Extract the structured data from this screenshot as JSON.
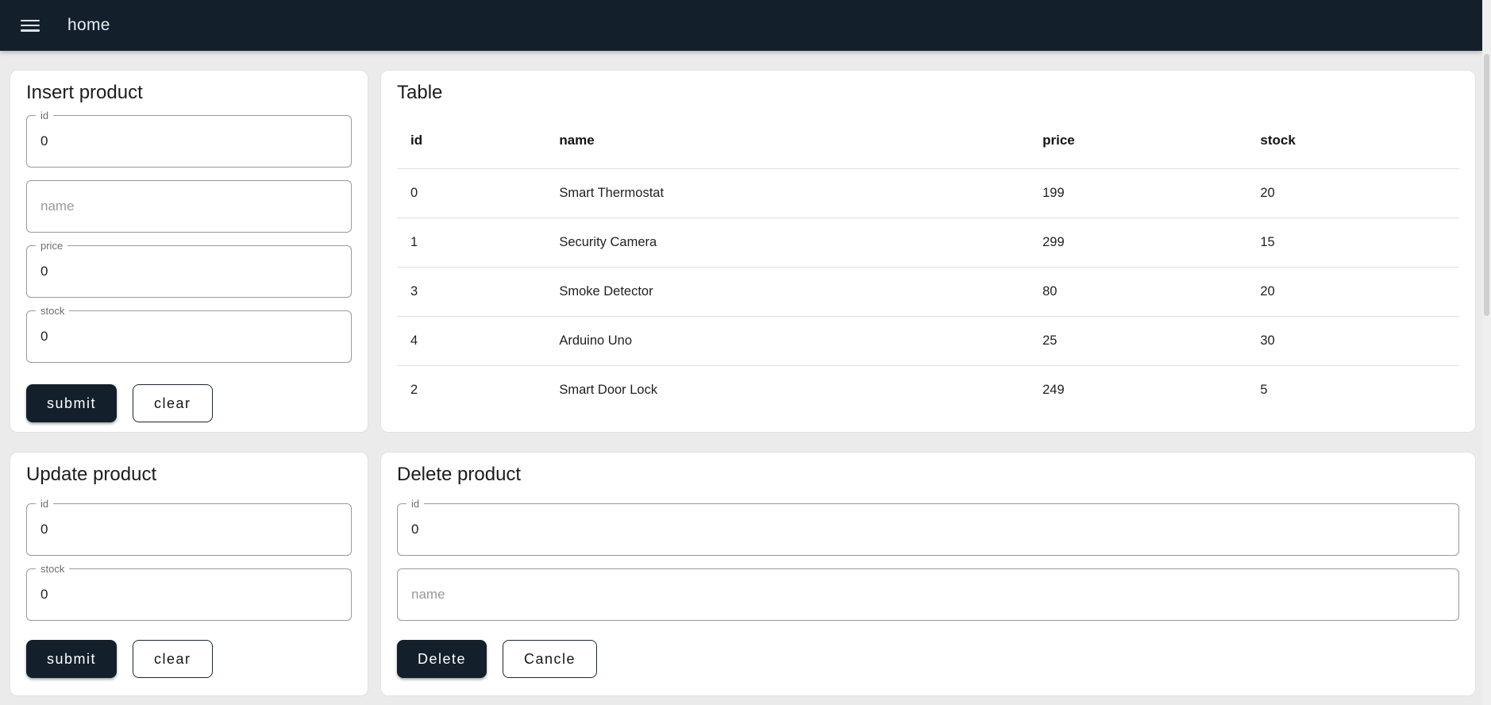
{
  "navbar": {
    "title": "home"
  },
  "insert_panel": {
    "title": "Insert product",
    "fields": {
      "id": {
        "label": "id",
        "value": "0"
      },
      "name": {
        "placeholder": "name",
        "value": ""
      },
      "price": {
        "label": "price",
        "value": "0"
      },
      "stock": {
        "label": "stock",
        "value": "0"
      }
    },
    "submit_label": "submit",
    "clear_label": "clear"
  },
  "table_panel": {
    "title": "Table",
    "columns": [
      "id",
      "name",
      "price",
      "stock"
    ],
    "rows": [
      [
        "0",
        "Smart Thermostat",
        "199",
        "20"
      ],
      [
        "1",
        "Security Camera",
        "299",
        "15"
      ],
      [
        "3",
        "Smoke Detector",
        "80",
        "20"
      ],
      [
        "4",
        "Arduino Uno",
        "25",
        "30"
      ],
      [
        "2",
        "Smart Door Lock",
        "249",
        "5"
      ]
    ]
  },
  "update_panel": {
    "title": "Update product",
    "fields": {
      "id": {
        "label": "id",
        "value": "0"
      },
      "stock": {
        "label": "stock",
        "value": "0"
      }
    },
    "submit_label": "submit",
    "clear_label": "clear"
  },
  "delete_panel": {
    "title": "Delete product",
    "fields": {
      "id": {
        "label": "id",
        "value": "0"
      },
      "name": {
        "placeholder": "name",
        "value": ""
      }
    },
    "delete_label": "Delete",
    "cancel_label": "Cancle"
  },
  "colors": {
    "navbar_bg": "#141f2c",
    "page_bg": "#ebebeb",
    "accent_dark": "#141f2c",
    "card_border": "#e2e2e2",
    "field_border": "#9a9a9a",
    "divider": "#e0e0e0"
  }
}
